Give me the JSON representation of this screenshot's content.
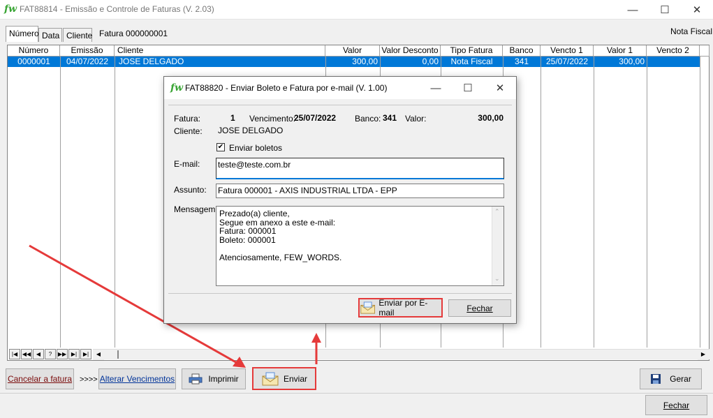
{
  "window": {
    "logo": "fw",
    "title": "FAT88814 - Emissão e Controle de  Faturas  (V. 2.03)",
    "minimize_glyph": "—",
    "maximize_glyph": "☐",
    "close_glyph": "✕"
  },
  "tabs": [
    {
      "label": "Número",
      "active": true
    },
    {
      "label": "Data",
      "active": false
    },
    {
      "label": "Cliente",
      "active": false
    }
  ],
  "tab_caption": "Fatura 000000001",
  "nota_fiscal_label": "Nota Fiscal",
  "grid": {
    "columns": [
      "Número",
      "Emissão",
      "Cliente",
      "Valor",
      "Valor Desconto",
      "Tipo Fatura",
      "Banco",
      "Vencto 1",
      "Valor 1",
      "Vencto 2"
    ],
    "rows": [
      [
        "0000001",
        "04/07/2022",
        "JOSE DELGADO",
        "300,00",
        "0,00",
        "Nota Fiscal",
        "341",
        "25/07/2022",
        "300,00",
        ""
      ]
    ],
    "selected_row_color": "#0078d7",
    "nav_buttons": [
      "|◀",
      "◀◀",
      "◀",
      "?",
      "▶▶",
      "▶|",
      "◀"
    ]
  },
  "bottom_buttons": {
    "cancelar": "Cancelar a fatura",
    "arrows": ">>>>",
    "alterar": "Alterar Vencimentos",
    "imprimir": "Imprimir",
    "enviar": "Enviar",
    "gerar": "Gerar",
    "fechar": "Fechar"
  },
  "dialog": {
    "logo": "fw",
    "title": "FAT88820 - Enviar Boleto e Fatura por e-mail  (V. 1.00)",
    "fatura_label": "Fatura:",
    "fatura_value": "1",
    "vencimento_label": "Vencimento:",
    "vencimento_value": "25/07/2022",
    "banco_label": "Banco:",
    "banco_value": "341",
    "valor_label": "Valor:",
    "valor_value": "300,00",
    "cliente_label": "Cliente:",
    "cliente_value": "JOSE DELGADO",
    "enviar_boletos_label": "Enviar boletos",
    "enviar_boletos_checked": true,
    "email_label": "E-mail:",
    "email_value": "teste@teste.com.br",
    "assunto_label": "Assunto:",
    "assunto_value": "Fatura 000001 - AXIS INDUSTRIAL LTDA - EPP",
    "mensagem_label": "Mensagem:",
    "mensagem_value": "Prezado(a) cliente,\nSegue em anexo a este e-mail:\nFatura: 000001\nBoleto: 000001\n\nAtenciosamente, FEW_WORDS.",
    "enviar_email_button": "Enviar por E-mail",
    "fechar_button": "Fechar"
  },
  "colors": {
    "accent": "#0078d7",
    "annotation_red": "#e53a3a",
    "logo_green": "#3aa535"
  }
}
